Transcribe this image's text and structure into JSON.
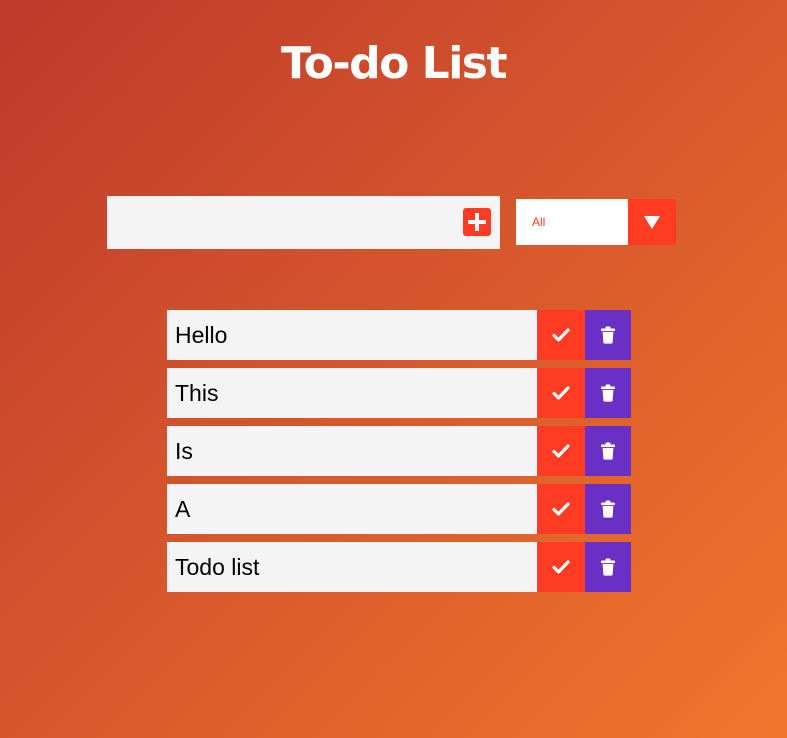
{
  "app": {
    "title": "To-do List"
  },
  "form": {
    "input_value": "",
    "input_placeholder": "",
    "add_icon": "plus-square-icon",
    "filter_selected": "All",
    "filter_arrow_icon": "caret-down-icon"
  },
  "todos": [
    {
      "text": "Hello"
    },
    {
      "text": "This"
    },
    {
      "text": "Is"
    },
    {
      "text": "A"
    },
    {
      "text": "Todo list"
    }
  ],
  "icons": {
    "complete": "check-icon",
    "delete": "trash-icon"
  },
  "colors": {
    "accent_red": "#ff3b24",
    "delete_purple": "#6a2fc4",
    "item_bg": "#f4f4f4",
    "bg_gradient_start": "#bd3a2b",
    "bg_gradient_end": "#f1762c"
  }
}
